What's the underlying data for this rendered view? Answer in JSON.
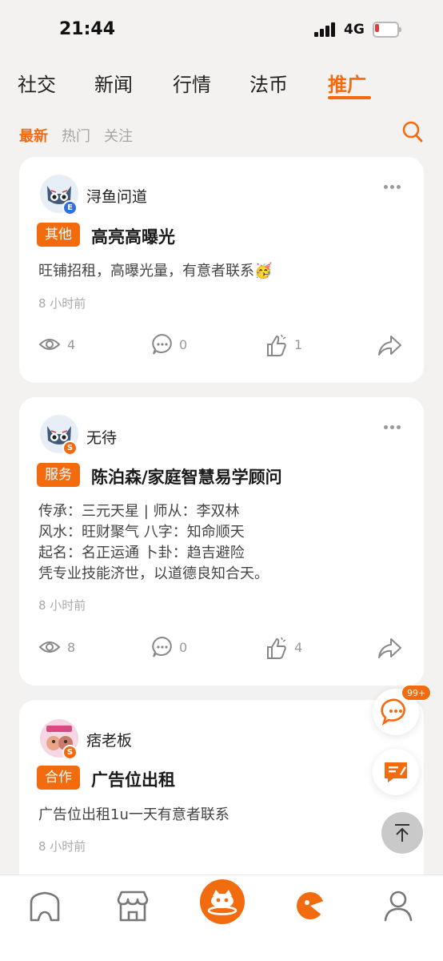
{
  "status_bar": {
    "time": "21:44",
    "network": "4G",
    "battery_level": 0.18
  },
  "main_tabs": [
    {
      "label": "社交",
      "active": false
    },
    {
      "label": "新闻",
      "active": false
    },
    {
      "label": "行情",
      "active": false
    },
    {
      "label": "法币",
      "active": false
    },
    {
      "label": "推广",
      "active": true
    }
  ],
  "sub_tabs": [
    {
      "label": "最新",
      "active": true
    },
    {
      "label": "热门",
      "active": false
    },
    {
      "label": "关注",
      "active": false
    }
  ],
  "posts": [
    {
      "user": "浔鱼问道",
      "badge": "E",
      "badge_color": "#2f6fe0",
      "tag": "其他",
      "title": "高亮高曝光",
      "body": "旺铺招租，高曝光量，有意者联系🥳",
      "time": "8 小时前",
      "views": "4",
      "comments": "0",
      "likes": "1"
    },
    {
      "user": "无待",
      "badge": "S",
      "badge_color": "#f26b0e",
      "tag": "服务",
      "title": "陈泊森/家庭智慧易学顾问",
      "body": "传承：三元天星 | 师从：李双林\n风水：旺财聚气 八字：知命顺天\n起名：名正运通 卜卦：趋吉避险\n凭专业技能济世，以道德良知合天。",
      "time": "8 小时前",
      "views": "8",
      "comments": "0",
      "likes": "4"
    },
    {
      "user": "痞老板",
      "badge": "S",
      "badge_color": "#f26b0e",
      "tag": "合作",
      "title": "广告位出租",
      "body": "广告位出租1u一天有意者联系",
      "time": "8 小时前"
    }
  ],
  "floating": {
    "chat_badge": "99+"
  },
  "colors": {
    "accent": "#f26b0e",
    "background": "#f4f2f1"
  },
  "icons": [
    "search-icon",
    "more-icon",
    "eye-icon",
    "comment-icon",
    "like-icon",
    "share-icon",
    "chat-icon",
    "edit-icon",
    "back-to-top-icon",
    "home-icon",
    "market-icon",
    "mascot-icon",
    "pie-icon",
    "profile-icon"
  ]
}
